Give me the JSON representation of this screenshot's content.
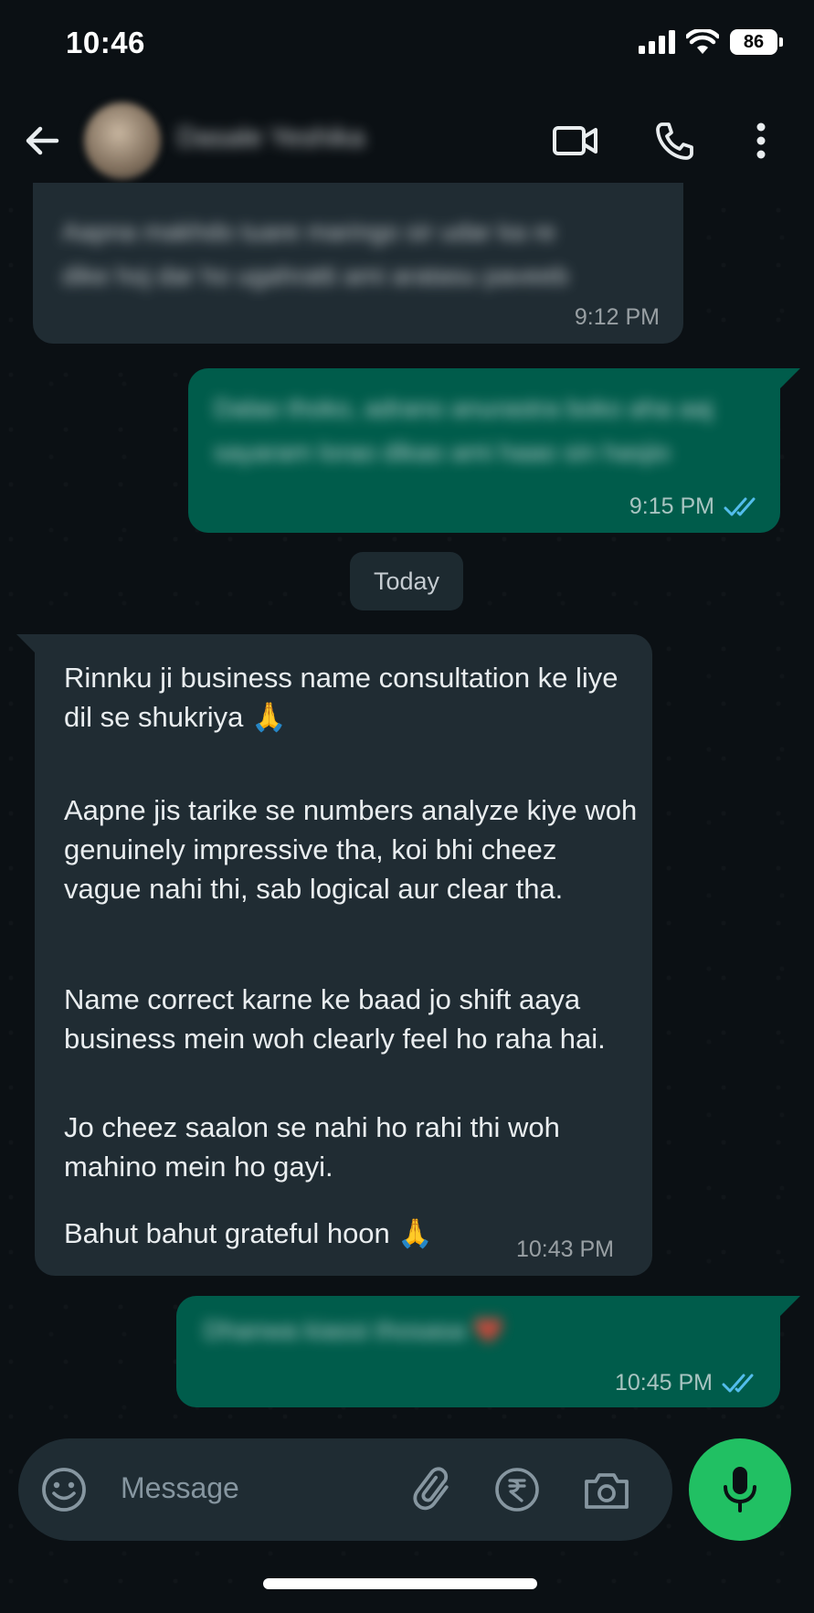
{
  "status_bar": {
    "time": "10:46",
    "battery": "86"
  },
  "header": {
    "contact_name": "Dasale Yeshika"
  },
  "messages": [
    {
      "id": "m1",
      "direction": "incoming",
      "blurred": true,
      "lines": [
        "Aapna makhdo tuare maringo sir udar ka re",
        "dike hoj dar ho ugahratti ami aratasu paveeb"
      ],
      "time": "9:12 PM"
    },
    {
      "id": "m2",
      "direction": "outgoing",
      "blurred": true,
      "lines": [
        "Dalao thoko, adrano anurastra boko aha aaj",
        "sayaram lorao dikao ami haao sin hasjio"
      ],
      "time": "9:15 PM",
      "status": "read"
    },
    {
      "id": "m3",
      "direction": "incoming",
      "blurred": false,
      "paragraphs": [
        "Rinnku ji business name consultation ke liye dil se shukriya 🙏",
        "Aapne jis tarike se numbers analyze kiye woh genuinely impressive tha, koi bhi cheez vague nahi thi, sab logical aur clear tha.",
        "Name correct karne ke baad jo shift aaya business mein woh clearly feel ho raha hai.",
        "Jo cheez saalon se nahi ho rahi thi woh mahino mein ho gayi.",
        "Bahut bahut grateful hoon 🙏"
      ],
      "time": "10:43 PM"
    },
    {
      "id": "m4",
      "direction": "outgoing",
      "blurred": true,
      "lines": [
        "Dhanwa kiassi thosasa ❤️"
      ],
      "time": "10:45 PM",
      "status": "read"
    }
  ],
  "date_chip": "Today",
  "input": {
    "placeholder": "Message"
  },
  "icons": {
    "back": "arrow-left-icon",
    "video": "video-call-icon",
    "call": "phone-icon",
    "menu": "more-vertical-icon",
    "emoji": "emoji-icon",
    "attach": "paperclip-icon",
    "payment": "rupee-icon",
    "camera": "camera-icon",
    "mic": "microphone-icon"
  },
  "colors": {
    "background": "#0b1014",
    "incoming_bubble": "#202c33",
    "outgoing_bubble": "#005c4b",
    "accent": "#21c063",
    "read_ticks": "#53bdeb"
  }
}
